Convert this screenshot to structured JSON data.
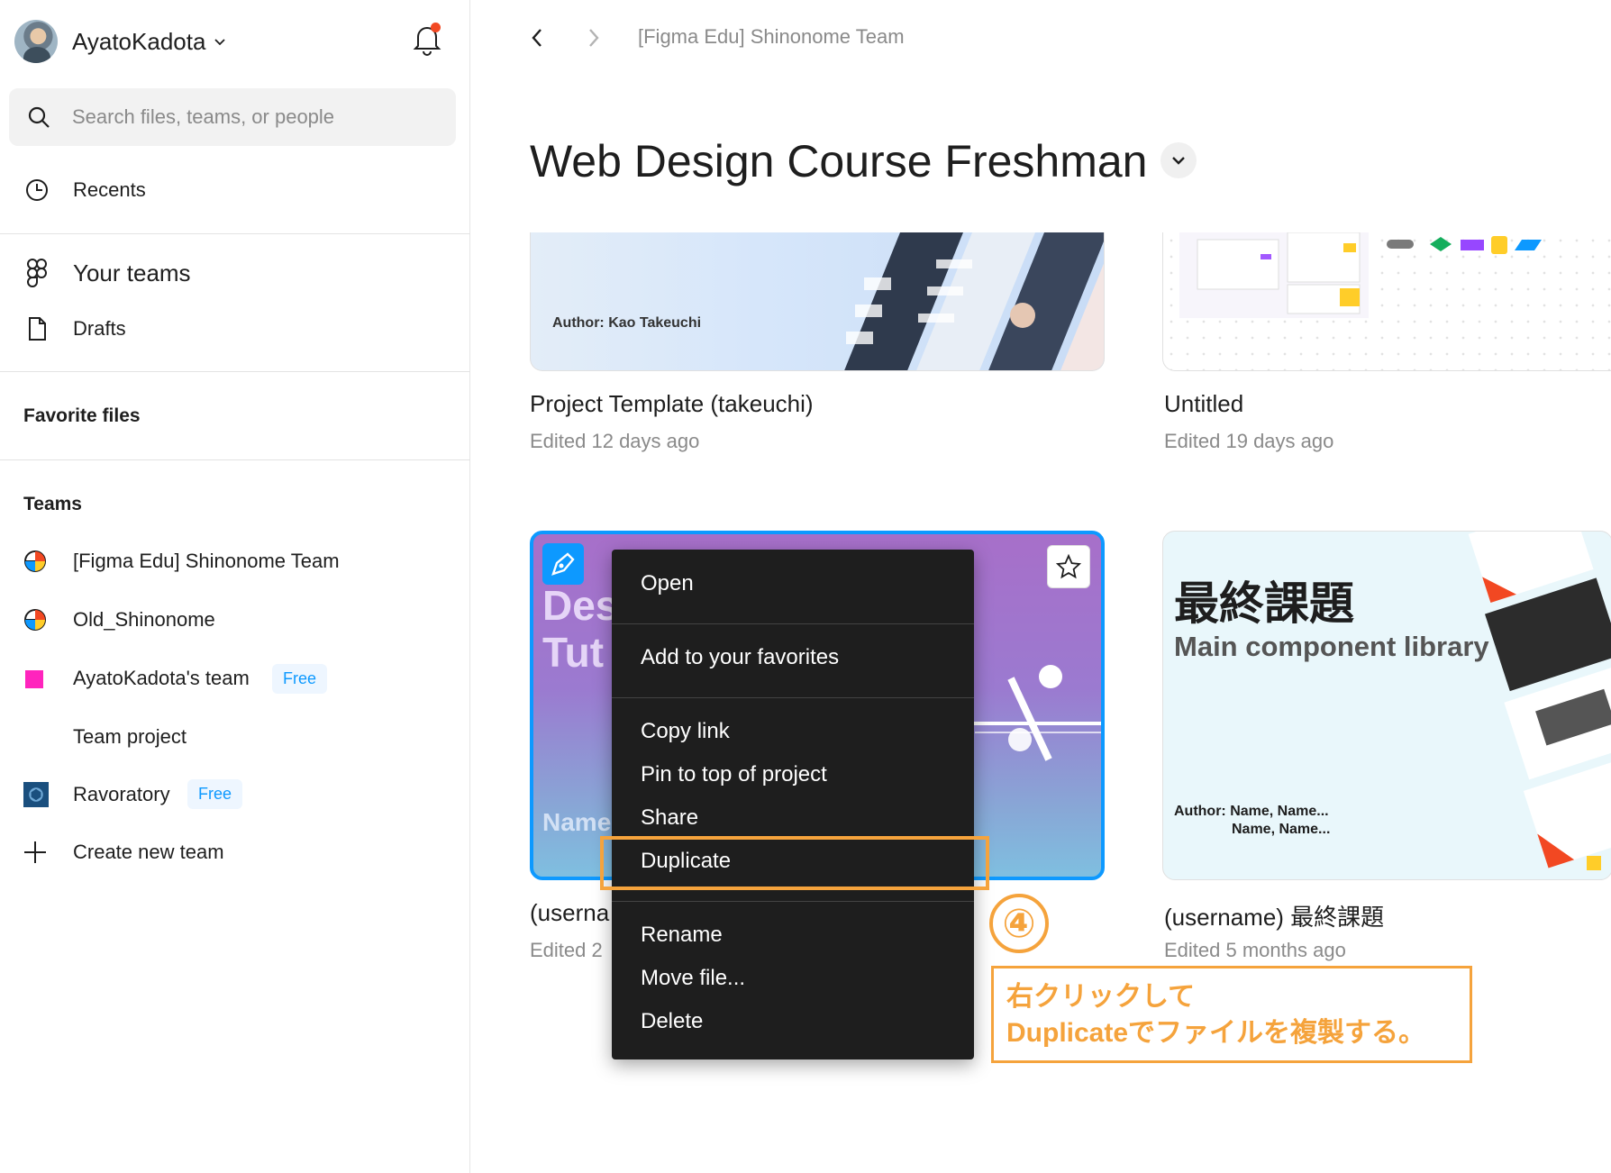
{
  "user": {
    "name": "AyatoKadota"
  },
  "search": {
    "placeholder": "Search files, teams, or people"
  },
  "nav": {
    "recents": "Recents",
    "your_teams": "Your teams",
    "drafts": "Drafts"
  },
  "sections": {
    "favorite_files": "Favorite files",
    "teams": "Teams"
  },
  "teams": [
    {
      "label": "[Figma Edu] Shinonome Team",
      "icon": "team-logo-icon"
    },
    {
      "label": "Old_Shinonome",
      "icon": "team-logo-icon"
    },
    {
      "label": "AyatoKadota's team",
      "badge": "Free",
      "icon": "pink-square-icon"
    },
    {
      "label": "Team project"
    },
    {
      "label": "Ravoratory",
      "badge": "Free",
      "icon": "ravoratory-logo-icon"
    },
    {
      "label": "Create new team",
      "icon": "plus-icon"
    }
  ],
  "breadcrumb": "[Figma Edu] Shinonome Team",
  "page_title": "Web Design Course Freshman",
  "files": [
    {
      "name": "Project Template (takeuchi)",
      "meta": "Edited 12 days ago",
      "thumb_text": "Author: Kao Takeuchi"
    },
    {
      "name": "Untitled",
      "meta": "Edited 19 days ago"
    },
    {
      "name": "(userna",
      "meta": "Edited 2",
      "thumb_title_1": "Des",
      "thumb_title_2": "Tut",
      "thumb_name": "Name"
    },
    {
      "name": "(username) 最終課題",
      "meta": "Edited 5 months ago",
      "thumb_title": "最終課題",
      "thumb_subtitle": "Main component library",
      "thumb_author_1": "Author: Name, Name...",
      "thumb_author_2": "Name, Name..."
    }
  ],
  "context_menu": {
    "open": "Open",
    "add_favorites": "Add to your favorites",
    "copy_link": "Copy link",
    "pin": "Pin to top of project",
    "share": "Share",
    "duplicate": "Duplicate",
    "rename": "Rename",
    "move": "Move file...",
    "delete": "Delete"
  },
  "annotation": {
    "step": "④",
    "line1": "右クリックして",
    "line2": "Duplicateでファイルを複製する。",
    "color": "#f5a33c"
  },
  "colors": {
    "accent": "#0d99ff",
    "notification": "#f24822"
  }
}
